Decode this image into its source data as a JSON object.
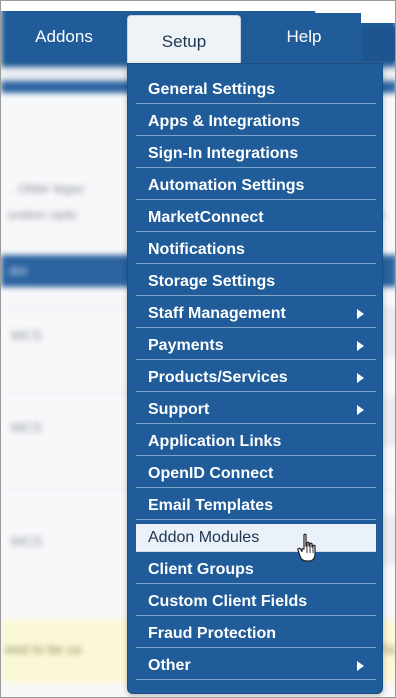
{
  "nav": {
    "addons": "Addons",
    "setup": "Setup",
    "help": "Help"
  },
  "background": {
    "line1": ". Older legac",
    "line1_right": "r",
    "line2": "uration optic",
    "line2_right": "re",
    "table_header": "dor",
    "rows": [
      "MCS",
      "MCS",
      "MCS"
    ],
    "notice": "eed to be us",
    "notice_right": "Fla"
  },
  "setup_menu": {
    "items": [
      {
        "label": "General Settings",
        "submenu": false
      },
      {
        "label": "Apps & Integrations",
        "submenu": false
      },
      {
        "label": "Sign-In Integrations",
        "submenu": false
      },
      {
        "label": "Automation Settings",
        "submenu": false
      },
      {
        "label": "MarketConnect",
        "submenu": false
      },
      {
        "label": "Notifications",
        "submenu": false
      },
      {
        "label": "Storage Settings",
        "submenu": false
      },
      {
        "label": "Staff Management",
        "submenu": true
      },
      {
        "label": "Payments",
        "submenu": true
      },
      {
        "label": "Products/Services",
        "submenu": true
      },
      {
        "label": "Support",
        "submenu": true
      },
      {
        "label": "Application Links",
        "submenu": false
      },
      {
        "label": "OpenID Connect",
        "submenu": false
      },
      {
        "label": "Email Templates",
        "submenu": false
      },
      {
        "label": "Addon Modules",
        "submenu": false,
        "active": true
      },
      {
        "label": "Client Groups",
        "submenu": false
      },
      {
        "label": "Custom Client Fields",
        "submenu": false
      },
      {
        "label": "Fraud Protection",
        "submenu": false
      },
      {
        "label": "Other",
        "submenu": true
      }
    ]
  },
  "colors": {
    "nav_blue": "#1f5c99",
    "menu_blue": "#1f5c99",
    "active_item_bg": "#eaf1f9",
    "notice_bg": "#fbf8d7"
  },
  "icons": {
    "submenu": "caret-right-icon",
    "pointer": "hand-pointer-icon"
  }
}
